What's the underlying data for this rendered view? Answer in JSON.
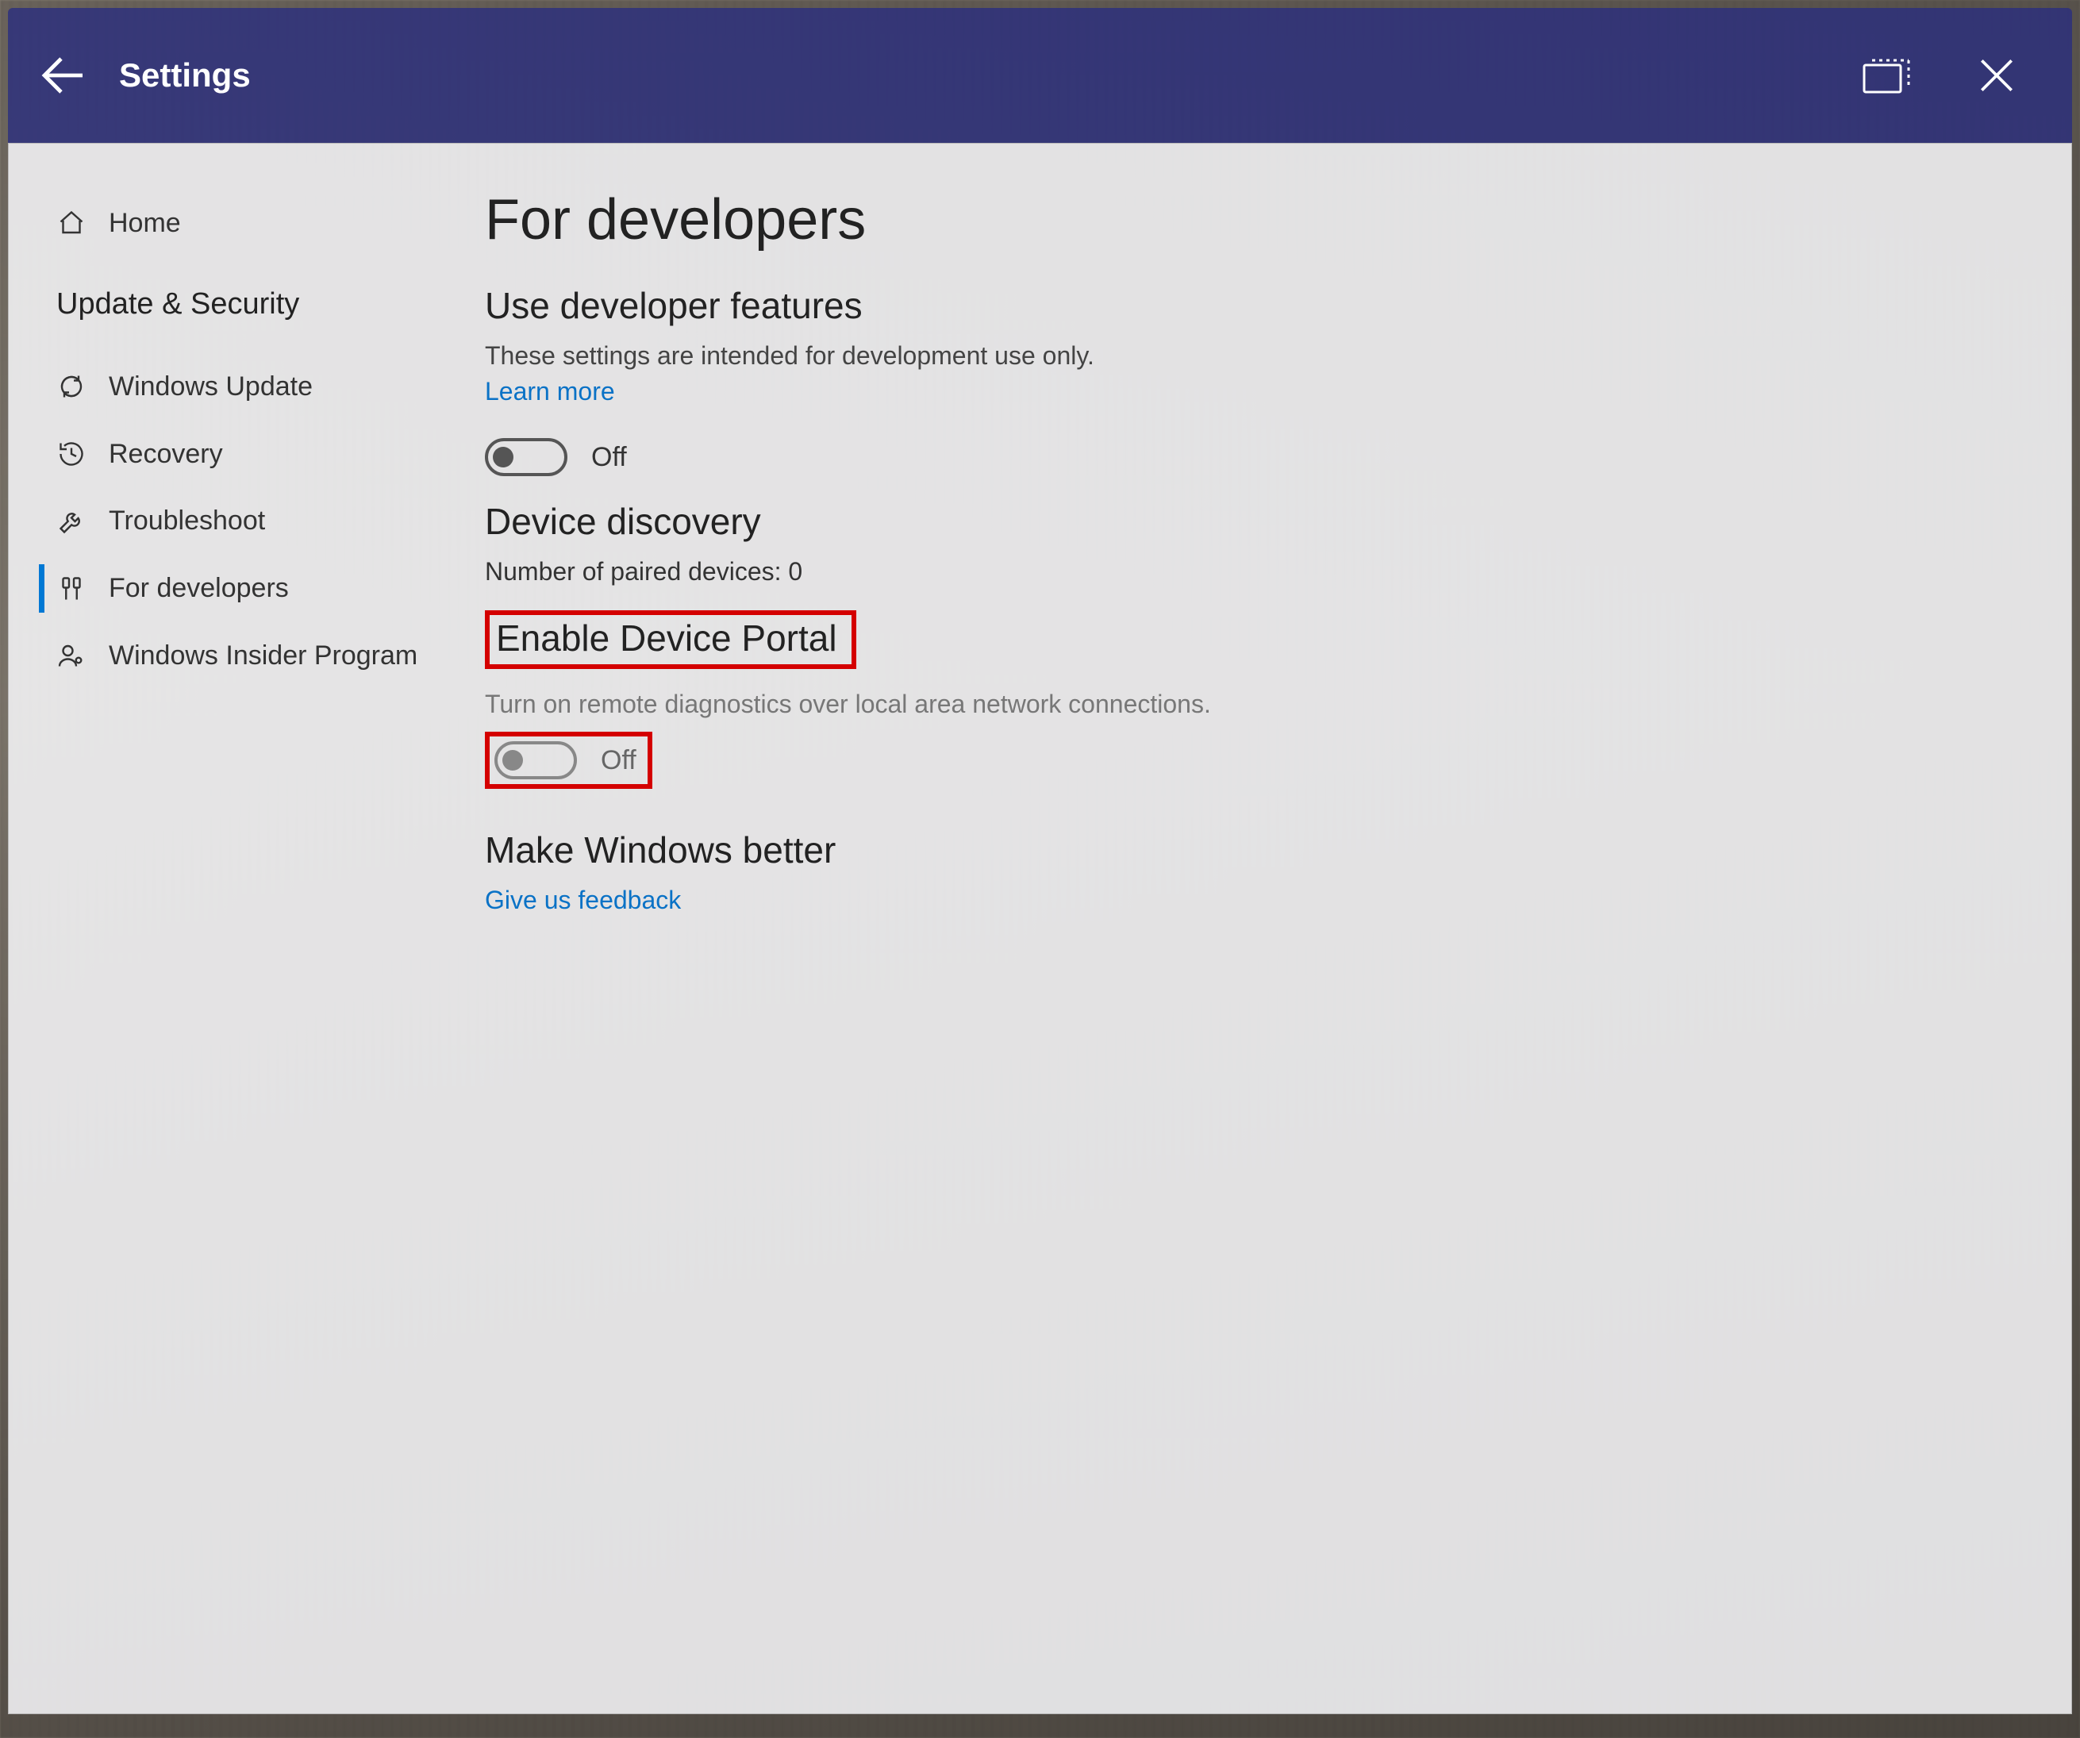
{
  "titlebar": {
    "title": "Settings"
  },
  "sidebar": {
    "home": "Home",
    "category": "Update & Security",
    "items": [
      {
        "label": "Windows Update"
      },
      {
        "label": "Recovery"
      },
      {
        "label": "Troubleshoot"
      },
      {
        "label": "For developers"
      },
      {
        "label": "Windows Insider Program"
      }
    ]
  },
  "content": {
    "page_title": "For developers",
    "dev_features": {
      "heading": "Use developer features",
      "desc": "These settings are intended for development use only.",
      "learn_more": "Learn more",
      "toggle_state": "Off"
    },
    "discovery": {
      "heading": "Device discovery",
      "paired_label": "Number of paired devices: 0"
    },
    "portal": {
      "heading": "Enable Device Portal",
      "desc": "Turn on remote diagnostics over local area network connections.",
      "toggle_state": "Off"
    },
    "feedback": {
      "heading": "Make Windows better",
      "link": "Give us feedback"
    }
  },
  "annotation": {
    "highlight_color": "#d40000"
  }
}
